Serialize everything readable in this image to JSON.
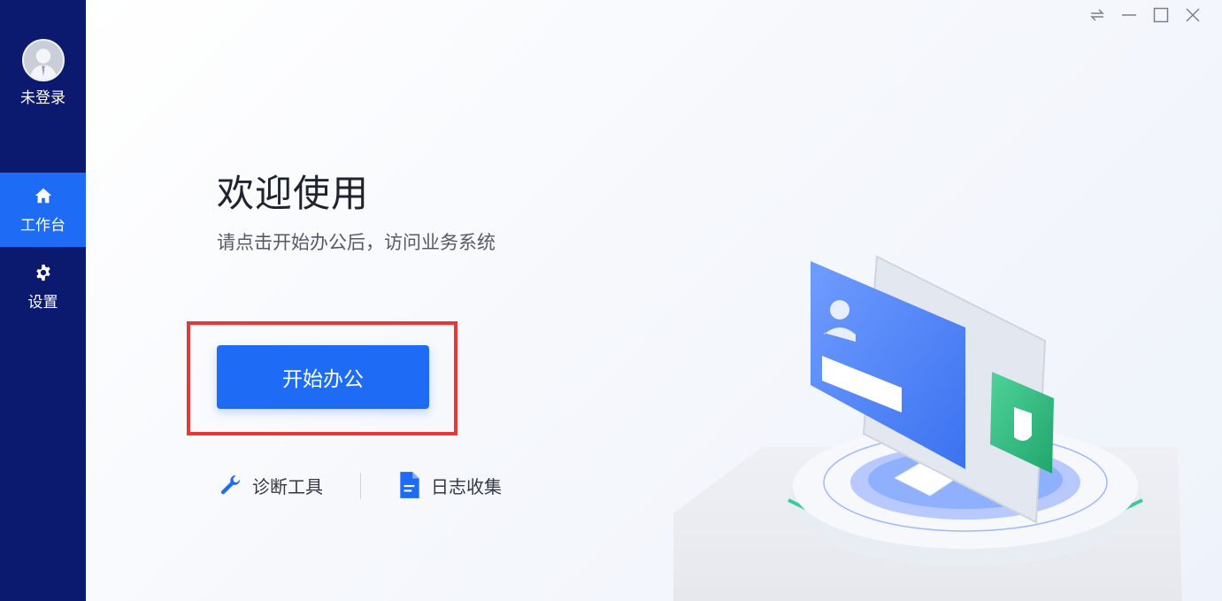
{
  "sidebar": {
    "user_label": "未登录",
    "items": [
      {
        "label": "工作台",
        "icon": "home-icon",
        "active": true
      },
      {
        "label": "设置",
        "icon": "gear-icon",
        "active": false
      }
    ]
  },
  "window_controls": [
    "swap-icon",
    "minimize-icon",
    "maximize-icon",
    "close-icon"
  ],
  "main": {
    "title": "欢迎使用",
    "subtitle": "请点击开始办公后，访问业务系统",
    "start_button": "开始办公",
    "links": [
      {
        "label": "诊断工具",
        "icon": "wrench-icon"
      },
      {
        "label": "日志收集",
        "icon": "document-icon"
      }
    ]
  },
  "colors": {
    "sidebar_bg": "#0b1a6e",
    "accent": "#1e6cf6",
    "highlight": "#e53935"
  }
}
